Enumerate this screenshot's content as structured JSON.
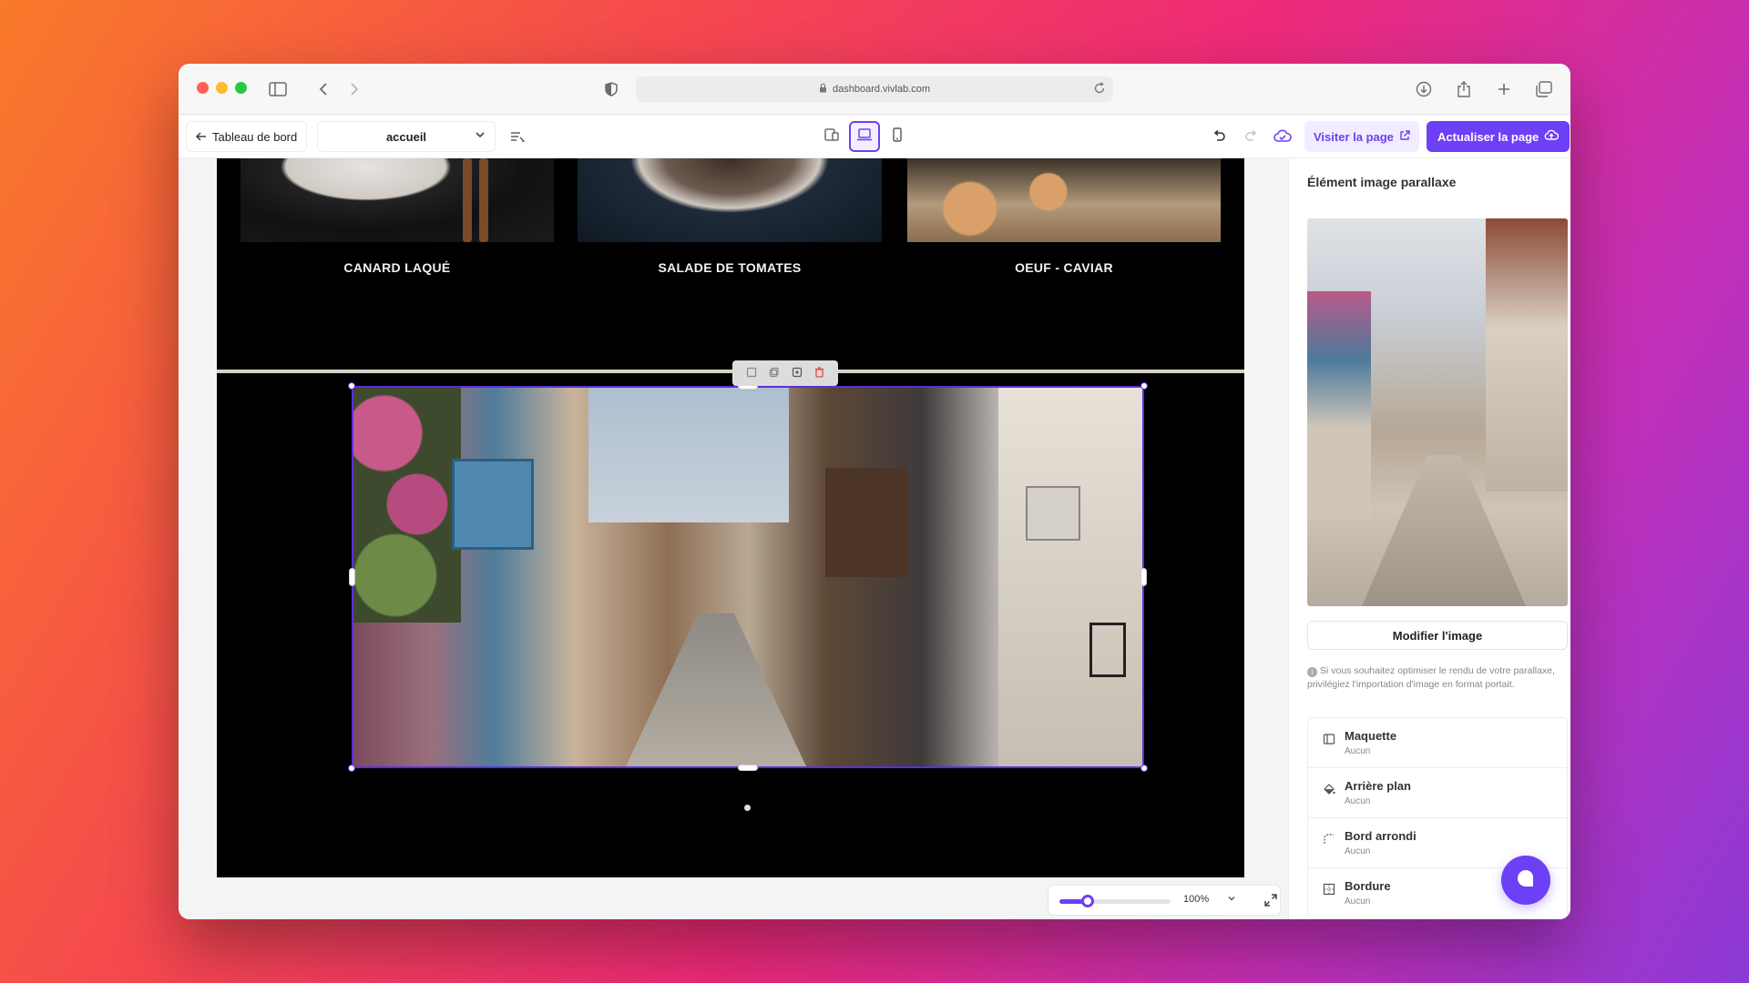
{
  "browser": {
    "url": "dashboard.vivlab.com"
  },
  "toolbar": {
    "back_label": "Tableau de bord",
    "page_select_value": "accueil",
    "visit_label": "Visiter la page",
    "update_label": "Actualiser la page"
  },
  "canvas": {
    "dishes": [
      {
        "title": "CANARD LAQUÉ"
      },
      {
        "title": "SALADE DE TOMATES"
      },
      {
        "title": "OEUF - CAVIAR"
      }
    ],
    "zoom": {
      "value_label": "100%",
      "slider_fraction": 0.25
    }
  },
  "panel": {
    "title": "Élément image parallaxe",
    "modify_label": "Modifier l'image",
    "hint": "Si vous souhaitez optimiser le rendu de votre parallaxe, privilégiez l'importation d'image en format portait.",
    "properties": [
      {
        "label": "Maquette",
        "value": "Aucun",
        "icon": "layout-icon"
      },
      {
        "label": "Arrière plan",
        "value": "Aucun",
        "icon": "paint-bucket-icon"
      },
      {
        "label": "Bord arrondi",
        "value": "Aucun",
        "icon": "rounded-corner-icon"
      },
      {
        "label": "Bordure",
        "value": "Aucun",
        "icon": "border-icon"
      }
    ]
  },
  "colors": {
    "accent": "#6d3ff5",
    "danger": "#e24848"
  }
}
